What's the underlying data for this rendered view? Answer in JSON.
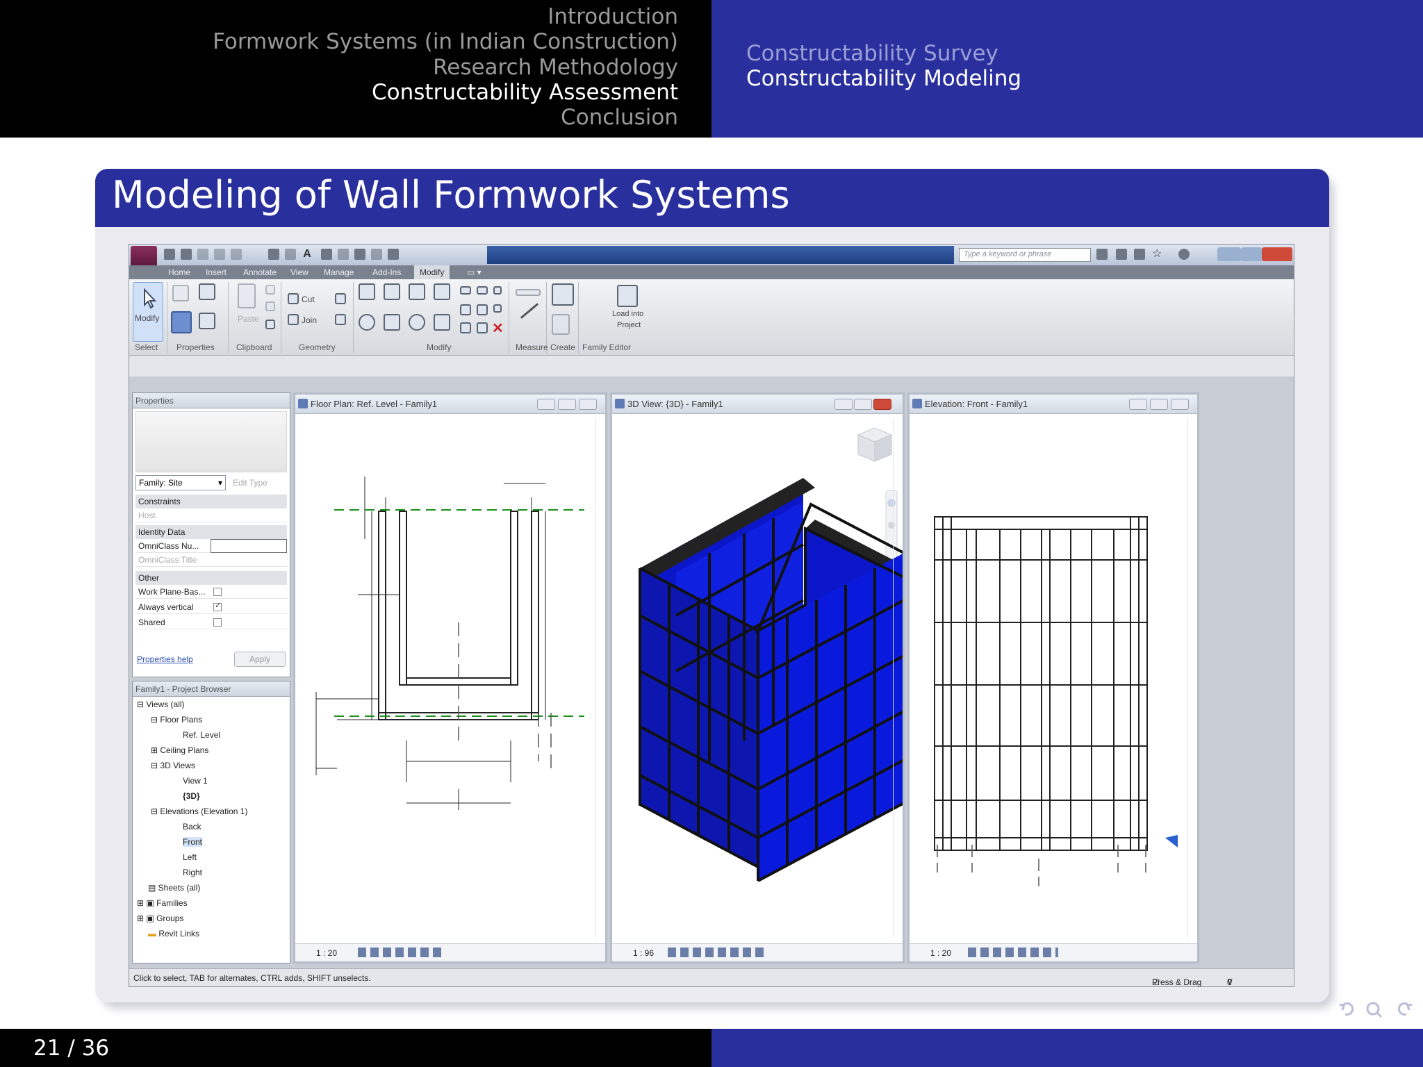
{
  "header": {
    "sections": [
      {
        "label": "Introduction",
        "active": false
      },
      {
        "label": "Formwork Systems (in Indian Construction)",
        "active": false
      },
      {
        "label": "Research Methodology",
        "active": false
      },
      {
        "label": "Constructability Assessment",
        "active": true
      },
      {
        "label": "Conclusion",
        "active": false
      }
    ],
    "subsections": [
      {
        "label": "Constructability Survey",
        "active": false
      },
      {
        "label": "Constructability Modeling",
        "active": true
      }
    ]
  },
  "slide": {
    "title": "Modeling of Wall Formwork Systems"
  },
  "revit": {
    "search_placeholder": "Type a keyword or phrase",
    "tabs": [
      "Home",
      "Insert",
      "Annotate",
      "View",
      "Manage",
      "Add-Ins",
      "Modify"
    ],
    "active_tab": "Modify",
    "ribbon": {
      "modify_label": "Modify",
      "cut_label": "Cut",
      "join_label": "Join",
      "paste_label": "Paste",
      "load_into_project": [
        "Load into",
        "Project"
      ],
      "groups": [
        "Select",
        "Properties",
        "Clipboard",
        "Geometry",
        "Modify",
        "Measure",
        "Create",
        "Family Editor"
      ]
    },
    "properties": {
      "title": "Properties",
      "family_select": "Family: Site",
      "edit_type": "Edit Type",
      "rows": {
        "constraints": "Constraints",
        "host": "Host",
        "identity": "Identity Data",
        "omniclass_no": "OmniClass Nu...",
        "omniclass_title": "OmniClass Title",
        "other": "Other",
        "work_plane": "Work Plane-Bas...",
        "always_vertical": "Always vertical",
        "shared": "Shared"
      },
      "help_link": "Properties help",
      "apply": "Apply"
    },
    "browser": {
      "title": "Family1 - Project Browser",
      "items": {
        "views_all": "Views (all)",
        "floor_plans": "Floor Plans",
        "ref_level": "Ref. Level",
        "ceiling_plans": "Ceiling Plans",
        "views_3d": "3D Views",
        "view1": "View 1",
        "v3d": "{3D}",
        "elevations": "Elevations (Elevation 1)",
        "back": "Back",
        "front": "Front",
        "left": "Left",
        "right": "Right",
        "sheets": "Sheets (all)",
        "families": "Families",
        "groups": "Groups",
        "revit_links": "Revit Links"
      }
    },
    "views": {
      "floor_plan": {
        "title": "Floor Plan: Ref. Level - Family1",
        "scale": "1 : 20"
      },
      "view_3d": {
        "title": "3D View: {3D} - Family1",
        "scale": "1 : 96"
      },
      "elevation": {
        "title": "Elevation: Front - Family1",
        "scale": "1 : 20"
      }
    },
    "status": {
      "text": "Click to select, TAB for alternates, CTRL adds, SHIFT unselects.",
      "press_drag": "Press & Drag",
      "filter_count": "0"
    }
  },
  "footer": {
    "page": "21 / 36"
  }
}
